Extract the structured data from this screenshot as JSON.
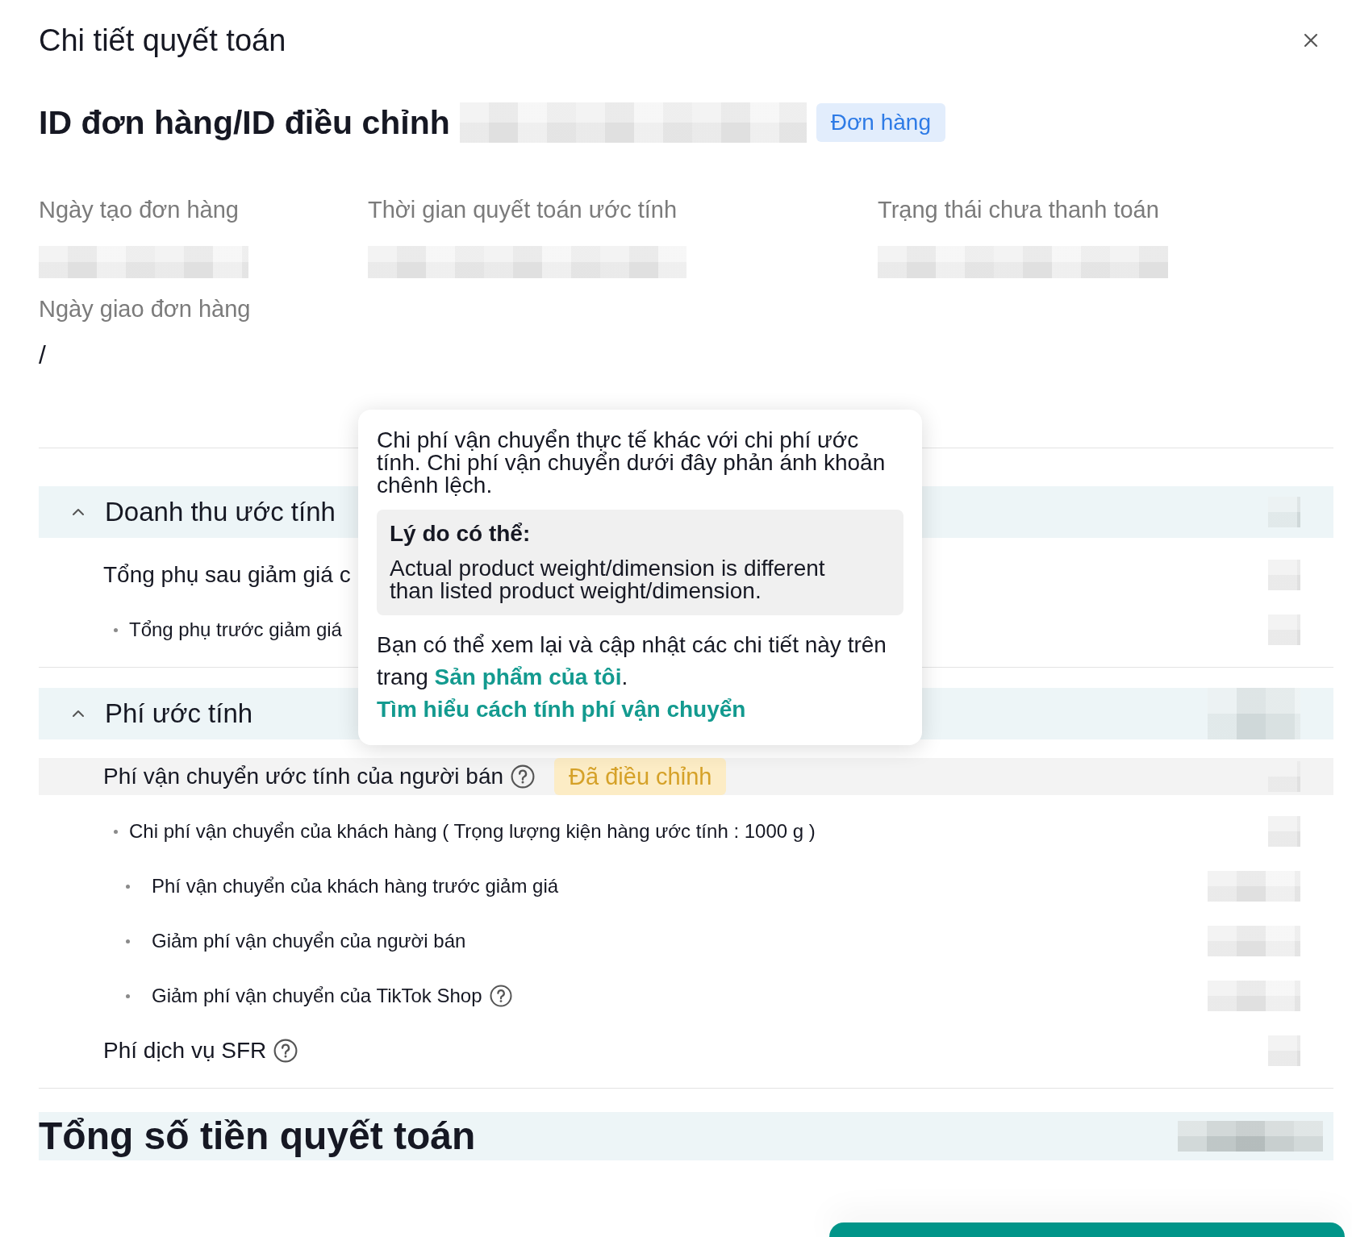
{
  "dialog": {
    "title": "Chi tiết quyết toán"
  },
  "order": {
    "label": "ID đơn hàng/ID điều chỉnh",
    "tag": "Đơn hàng"
  },
  "details": [
    {
      "label": "Ngày tạo đơn hàng",
      "kind": "hidden"
    },
    {
      "label": "Thời gian quyết toán ước tính",
      "kind": "hidden"
    },
    {
      "label": "Trạng thái chưa thanh toán",
      "kind": "hidden"
    },
    {
      "label": "Ngày giao đơn hàng",
      "kind": "text",
      "value": "/"
    }
  ],
  "sections": [
    {
      "title": "Doanh thu ước tính",
      "expanded": true,
      "rows": [
        {
          "label": "Tổng phụ sau giảm giá c",
          "help": false,
          "highlighted": false,
          "children": [
            {
              "label": "Tổng phụ trước giảm giá",
              "help": false
            }
          ]
        }
      ]
    },
    {
      "title": "Phí ước tính",
      "expanded": true,
      "rows": [
        {
          "label": "Phí vận chuyển ước tính của người bán",
          "help": true,
          "badge": "Đã điều chỉnh",
          "highlighted": true,
          "children": [
            {
              "label": "Chi phí vận chuyển của khách hàng ( Trọng lượng kiện hàng ước tính : 1000 g )",
              "help": false,
              "children": [
                {
                  "label": "Phí vận chuyển của khách hàng trước giảm giá",
                  "help": false
                },
                {
                  "label": "Giảm phí vận chuyển của người bán",
                  "help": false
                },
                {
                  "label": "Giảm phí vận chuyển của TikTok Shop",
                  "help": true
                }
              ]
            }
          ]
        },
        {
          "label": "Phí dịch vụ SFR",
          "help": true,
          "highlighted": false
        }
      ]
    }
  ],
  "total": {
    "label": "Tổng số tiền quyết toán"
  },
  "tooltip": {
    "text": "Chi phí vận chuyển thực tế khác với chi phí ước tính. Chi phí vận chuyển dưới đây phản ánh khoản chênh lệch.",
    "reason": {
      "title": "Lý do có thể:",
      "text": "Actual product weight/dimension is different than listed product weight/dimension."
    },
    "note": [
      {
        "kind": "text",
        "text": "Bạn có thể xem lại và cập nhật các chi tiết này trên trang "
      },
      {
        "kind": "link",
        "text": "Sản phẩm của tôi"
      },
      {
        "kind": "text",
        "text": ". "
      },
      {
        "kind": "link",
        "text": "Tìm hiểu cách tính phí vận chuyển"
      }
    ]
  }
}
